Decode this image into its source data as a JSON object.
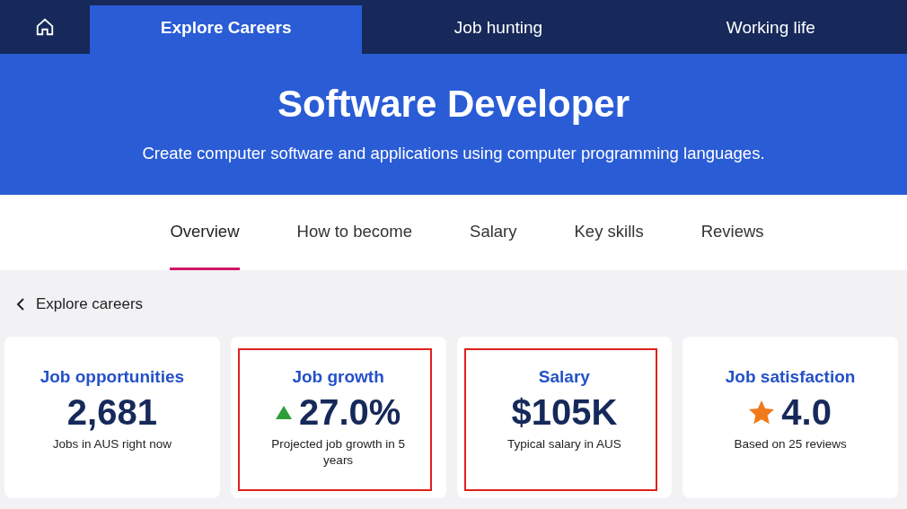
{
  "nav": {
    "tabs": [
      {
        "label": "Explore Careers",
        "selected": true
      },
      {
        "label": "Job hunting",
        "selected": false
      },
      {
        "label": "Working life",
        "selected": false
      }
    ]
  },
  "hero": {
    "title": "Software Developer",
    "subtitle": "Create computer software and applications using computer programming languages."
  },
  "section_tabs": [
    {
      "label": "Overview",
      "selected": true
    },
    {
      "label": "How to become",
      "selected": false
    },
    {
      "label": "Salary",
      "selected": false
    },
    {
      "label": "Key skills",
      "selected": false
    },
    {
      "label": "Reviews",
      "selected": false
    }
  ],
  "back_link": "Explore careers",
  "stats": [
    {
      "kind": "plain",
      "title": "Job opportunities",
      "value": "2,681",
      "caption": "Jobs in AUS right now",
      "highlighted": false
    },
    {
      "kind": "growth",
      "title": "Job growth",
      "value": "27.0%",
      "caption": "Projected job growth in 5 years",
      "highlighted": true
    },
    {
      "kind": "plain",
      "title": "Salary",
      "value": "$105K",
      "caption": "Typical salary in AUS",
      "highlighted": true
    },
    {
      "kind": "rating",
      "title": "Job satisfaction",
      "value": "4.0",
      "caption": "Based on 25 reviews",
      "highlighted": false
    }
  ]
}
